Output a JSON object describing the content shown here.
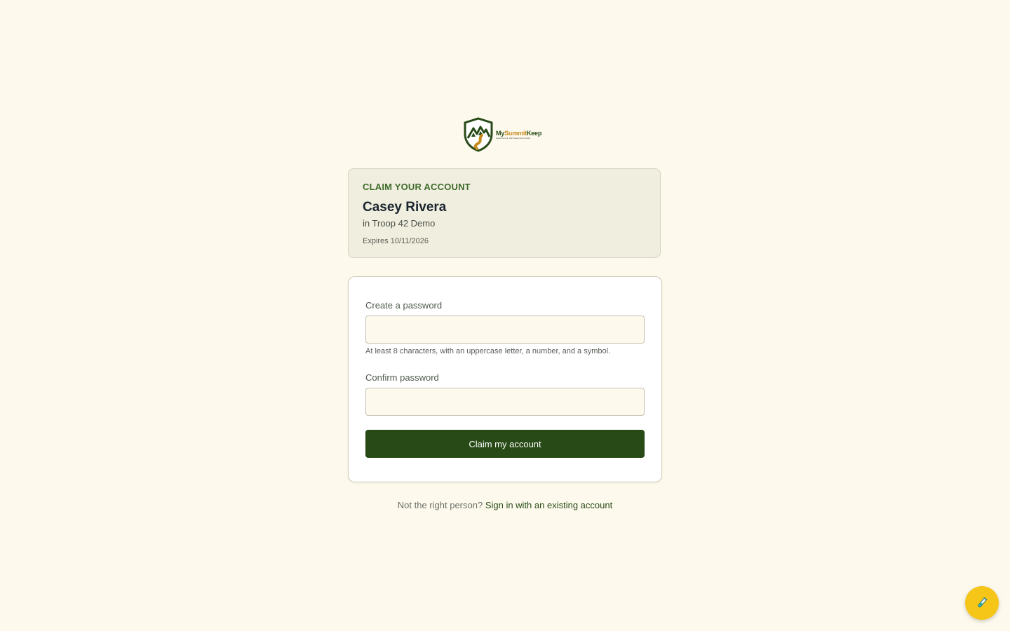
{
  "logo": {
    "brand_prefix": "My",
    "brand_accent": "Summit",
    "brand_suffix": "Keep",
    "tagline": "Lead the unit. We'll keep the records."
  },
  "claim_card": {
    "eyebrow": "CLAIM YOUR ACCOUNT",
    "name": "Casey Rivera",
    "troop": "in Troop 42 Demo",
    "expiry": "Expires 10/11/2026"
  },
  "form": {
    "password_label": "Create a password",
    "password_value": "",
    "password_hint": "At least 8 characters, with an uppercase letter, a number, and a symbol.",
    "confirm_label": "Confirm password",
    "confirm_value": "",
    "submit_label": "Claim my account"
  },
  "footer": {
    "prompt": "Not the right person?",
    "link_label": "Sign in with an existing account"
  },
  "fab": {
    "icon": "test-tube-icon"
  },
  "colors": {
    "background": "#fdf9ec",
    "brand_green": "#274a17",
    "brand_gold": "#c78a1f",
    "fab_yellow": "#f5c518"
  }
}
